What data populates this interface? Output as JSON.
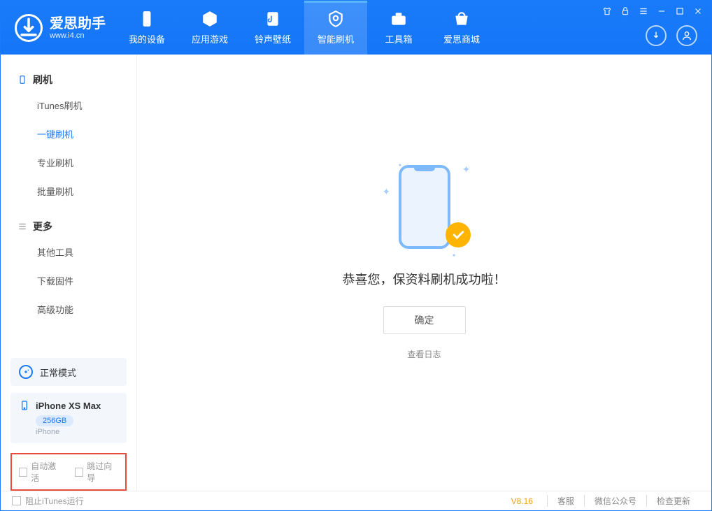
{
  "app": {
    "name": "爱思助手",
    "domain": "www.i4.cn"
  },
  "tabs": [
    {
      "label": "我的设备"
    },
    {
      "label": "应用游戏"
    },
    {
      "label": "铃声壁纸"
    },
    {
      "label": "智能刷机",
      "active": true
    },
    {
      "label": "工具箱"
    },
    {
      "label": "爱思商城"
    }
  ],
  "sidebar": {
    "group1": {
      "title": "刷机",
      "items": [
        "iTunes刷机",
        "一键刷机",
        "专业刷机",
        "批量刷机"
      ],
      "activeIndex": 1
    },
    "group2": {
      "title": "更多",
      "items": [
        "其他工具",
        "下载固件",
        "高级功能"
      ]
    }
  },
  "mode": {
    "label": "正常模式"
  },
  "device": {
    "name": "iPhone XS Max",
    "storage": "256GB",
    "type": "iPhone"
  },
  "checkboxes": {
    "autoActivate": "自动激活",
    "skipGuide": "跳过向导"
  },
  "main": {
    "successText": "恭喜您，保资料刷机成功啦！",
    "okBtn": "确定",
    "logLink": "查看日志"
  },
  "statusbar": {
    "preventItunes": "阻止iTunes运行",
    "version": "V8.16",
    "links": [
      "客服",
      "微信公众号",
      "检查更新"
    ]
  }
}
